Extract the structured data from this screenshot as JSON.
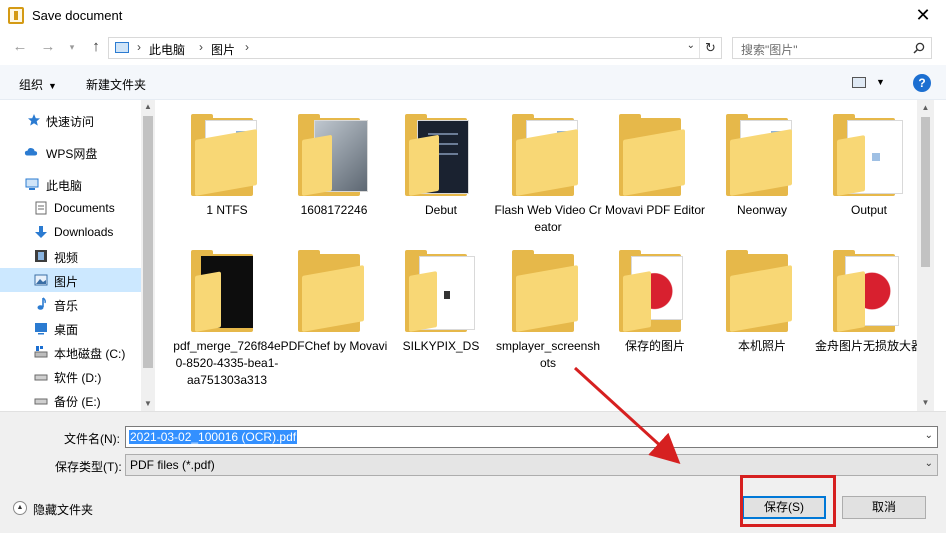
{
  "window": {
    "title": "Save document",
    "close_glyph": "✕"
  },
  "address": {
    "crumbs": [
      "此电脑",
      "图片"
    ],
    "search_placeholder": "搜索\"图片\""
  },
  "toolbar": {
    "organize": "组织",
    "new_folder": "新建文件夹",
    "help": "?"
  },
  "nav": {
    "items": [
      {
        "label": "快速访问",
        "icon": "star-icon"
      },
      {
        "label": "WPS网盘",
        "icon": "cloud-icon"
      },
      {
        "label": "此电脑",
        "icon": "computer-icon"
      },
      {
        "label": "Documents",
        "icon": "document-icon"
      },
      {
        "label": "Downloads",
        "icon": "download-icon"
      },
      {
        "label": "视频",
        "icon": "video-icon"
      },
      {
        "label": "图片",
        "icon": "picture-icon",
        "selected": true
      },
      {
        "label": "音乐",
        "icon": "music-icon"
      },
      {
        "label": "桌面",
        "icon": "desktop-icon"
      },
      {
        "label": "本地磁盘 (C:)",
        "icon": "drive-icon"
      },
      {
        "label": "软件 (D:)",
        "icon": "drive-icon"
      },
      {
        "label": "备份 (E:)",
        "icon": "drive-icon"
      }
    ]
  },
  "files": [
    {
      "name": "1 NTFS",
      "kind": "folder-docs"
    },
    {
      "name": "1608172246",
      "kind": "folder-photo"
    },
    {
      "name": "Debut",
      "kind": "folder-dark"
    },
    {
      "name": "Flash Web Video Creator",
      "kind": "folder-docs"
    },
    {
      "name": "Movavi PDF Editor",
      "kind": "folder-empty"
    },
    {
      "name": "Neonway",
      "kind": "folder-docs"
    },
    {
      "name": "Output",
      "kind": "folder-white"
    },
    {
      "name": "pdf_merge_726f84e0-8520-4335-bea1-aa751303a313",
      "kind": "folder-black"
    },
    {
      "name": "PDFChef by Movavi",
      "kind": "folder-empty"
    },
    {
      "name": "SILKYPIX_DS",
      "kind": "folder-white-small"
    },
    {
      "name": "smplayer_screenshots",
      "kind": "folder-empty"
    },
    {
      "name": "保存的图片",
      "kind": "folder-strawberry-paper"
    },
    {
      "name": "本机照片",
      "kind": "folder-empty"
    },
    {
      "name": "金舟图片无损放大器",
      "kind": "folder-strawberry"
    }
  ],
  "form": {
    "filename_label": "文件名(N):",
    "filename_value": "2021-03-02_100016 (OCR).pdf",
    "filetype_label": "保存类型(T):",
    "filetype_value": "PDF files (*.pdf)",
    "hide_folders": "隐藏文件夹",
    "save": "保存(S)",
    "cancel": "取消"
  },
  "colors": {
    "accent": "#0078d7",
    "selection": "#cce8ff",
    "annotation": "#d62020"
  }
}
